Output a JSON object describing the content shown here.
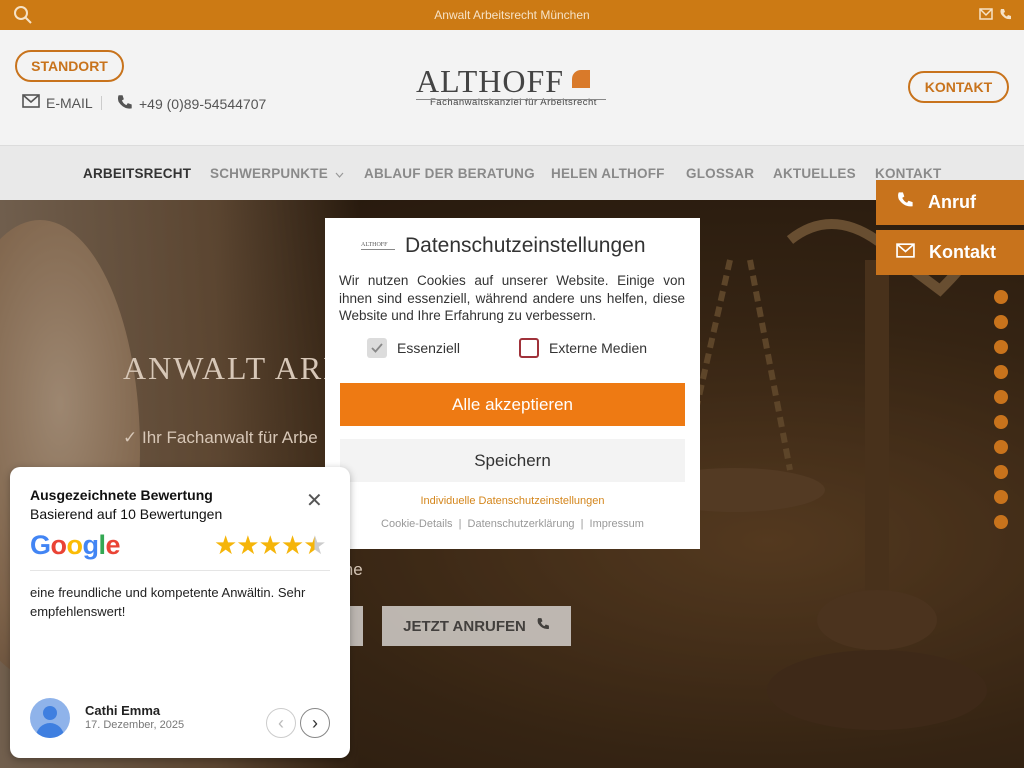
{
  "topbar": {
    "title": "Anwalt Arbeitsrecht München",
    "icons": [
      "search-icon",
      "mail-icon",
      "phone-icon"
    ]
  },
  "header": {
    "standort_label": "STANDORT",
    "email_label": "E-MAIL",
    "phone_label": "+49 (0)89-54544707",
    "kontakt_label": "KONTAKT",
    "logo": {
      "name": "ALTHOFF",
      "subtitle": "Fachanwaltskanzlei für Arbeitsrecht"
    }
  },
  "nav": {
    "items": [
      {
        "label": "ARBEITSRECHT",
        "active": true
      },
      {
        "label": "SCHWERPUNKTE"
      },
      {
        "label": "ABLAUF DER BERATUNG"
      },
      {
        "label": "HELEN ALTHOFF"
      },
      {
        "label": "GLOSSAR"
      },
      {
        "label": "AKTUELLES"
      },
      {
        "label": "KONTAKT"
      }
    ]
  },
  "hero": {
    "heading": "ANWALT ARBE",
    "subline": "✓ Ihr Fachanwalt für Arbe",
    "subline2": "ine",
    "call_button": "JETZT ANRUFEN"
  },
  "side": {
    "call_label": "Anruf",
    "contact_label": "Kontakt",
    "dot_count": 10
  },
  "cookie": {
    "title": "Datenschutzeinstellungen",
    "logo_text": "ALTHOFF",
    "text": "Wir nutzen Cookies auf unserer Website. Einige von ihnen sind essenziell, während andere uns helfen, diese Website und Ihre Erfahrung zu verbessern.",
    "essential_label": "Essenziell",
    "external_label": "Externe Medien",
    "accept_label": "Alle akzeptieren",
    "save_label": "Speichern",
    "individual_label": "Individuelle Datenschutzeinstellungen",
    "links": [
      "Cookie-Details",
      "Datenschutzerklärung",
      "Impressum"
    ]
  },
  "review": {
    "title": "Ausgezeichnete Bewertung",
    "subtitle": "Basierend auf 10 Bewertungen",
    "google": "Google",
    "rating_stars": 4.5,
    "text": "eine freundliche und kompetente Anwältin. Sehr empfehlenswert!",
    "author": "Cathi Emma",
    "date": "17. Dezember, 2025"
  },
  "colors": {
    "accent": "#c8731c",
    "accept": "#ee7a13",
    "topbar": "#cc7a14"
  }
}
